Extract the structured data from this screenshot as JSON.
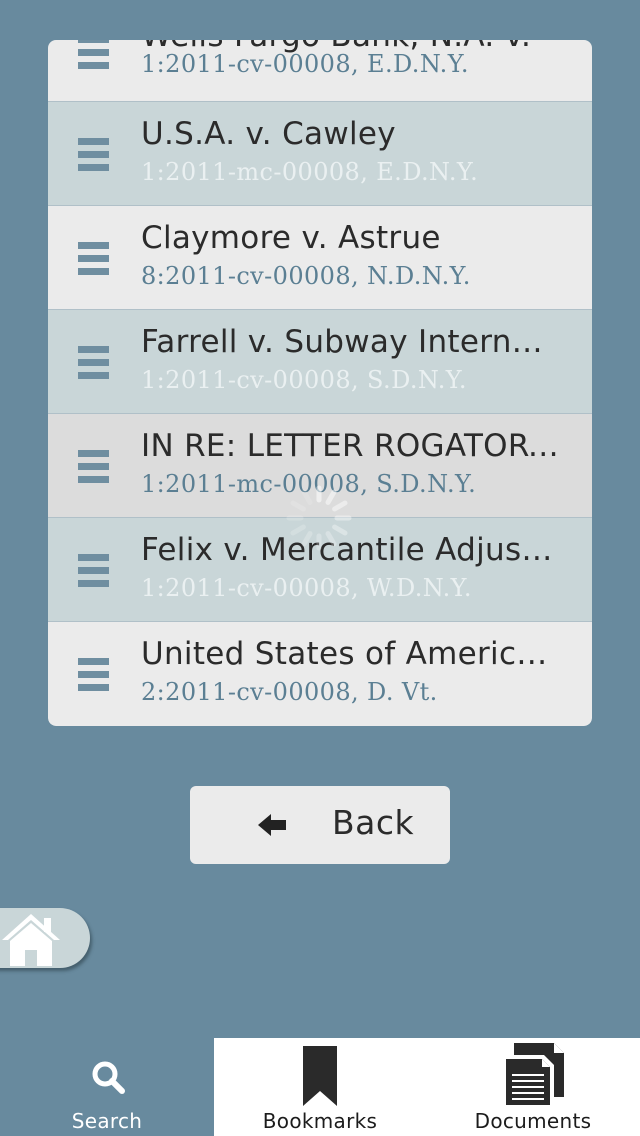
{
  "cases": [
    {
      "title": "Wells Fargo Bank, N.A. v.",
      "docket": "1:2011-cv-00008, E.D.N.Y."
    },
    {
      "title": "U.S.A. v. Cawley",
      "docket": "1:2011-mc-00008, E.D.N.Y."
    },
    {
      "title": "Claymore v. Astrue",
      "docket": "8:2011-cv-00008, N.D.N.Y."
    },
    {
      "title": "Farrell v. Subway Internat…",
      "docket": "1:2011-cv-00008, S.D.N.Y."
    },
    {
      "title": "IN RE: LETTER ROGATORY…",
      "docket": "1:2011-mc-00008, S.D.N.Y."
    },
    {
      "title": "Felix v. Mercantile Adjust…",
      "docket": "1:2011-cv-00008, W.D.N.Y."
    },
    {
      "title": "United States of America…",
      "docket": "2:2011-cv-00008, D. Vt."
    }
  ],
  "back_button": {
    "label": "Back",
    "icon": "arrow-left-icon"
  },
  "home_button": {
    "icon": "home-icon"
  },
  "tabs": [
    {
      "label": "Search",
      "icon": "search-icon",
      "active": true
    },
    {
      "label": "Bookmarks",
      "icon": "bookmark-icon",
      "active": false
    },
    {
      "label": "Documents",
      "icon": "documents-icon",
      "active": false
    }
  ],
  "colors": {
    "background": "#688a9e",
    "row_light": "#ebebeb",
    "row_tint": "#c9d6d8",
    "accent_text": "#5b7f93"
  }
}
